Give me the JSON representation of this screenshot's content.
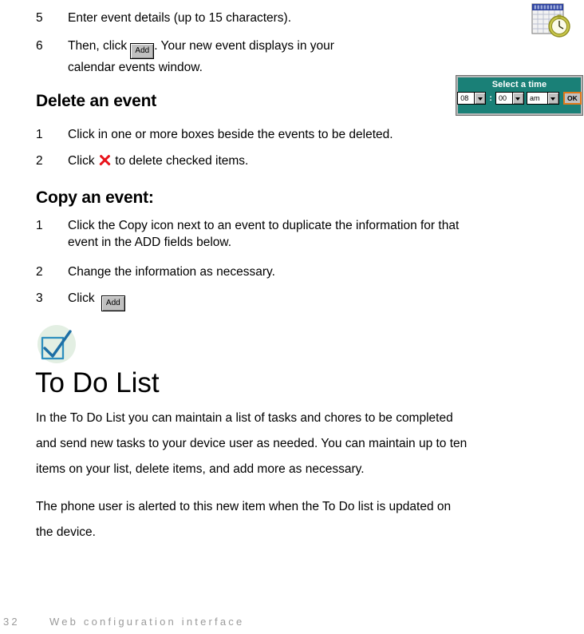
{
  "document": {
    "calendar_steps": [
      {
        "number": "5",
        "lines": [
          "Enter event details (up to 15 characters)."
        ]
      },
      {
        "number": "6",
        "pre_text": "Then, click",
        "button_label": "Add",
        "post_text": ". Your new event displays in your",
        "line2": "calendar events window."
      }
    ],
    "delete_section": {
      "heading": "Delete an event",
      "steps": [
        {
          "number": "1",
          "text": "Click in one or more boxes beside the events to be deleted."
        },
        {
          "number": "2",
          "pre_text": "Click",
          "icon": "red-x-icon",
          "post_text": "to delete checked items."
        }
      ]
    },
    "copy_section": {
      "heading": "Copy an event:",
      "steps": [
        {
          "number": "1",
          "line1": "Click the Copy icon next to an event to duplicate the information for that",
          "line2": "event in the ADD fields below."
        },
        {
          "number": "2",
          "text": "Change the information as necessary."
        },
        {
          "number": "3",
          "pre_text": "Click",
          "button_label": "Add"
        }
      ]
    },
    "todo_section": {
      "icon": "checkmark-box-icon",
      "heading": "To Do List",
      "paragraph1": [
        "In the To Do List you can maintain a list of tasks and chores to be completed",
        "and send new tasks to your device user as needed. You can maintain up to ten",
        "items on your list, delete items, and add more as necessary."
      ],
      "paragraph2": [
        "The phone user is alerted to this new item when the To Do list is updated on",
        "the device."
      ]
    }
  },
  "time_widget": {
    "title": "Select a time",
    "hour": "08",
    "separator": ":",
    "minute": "00",
    "meridiem": "am",
    "ok_label": "OK",
    "background_color": "#1a8077",
    "ok_border_color": "#e07818"
  },
  "icons": {
    "calendar_clock": "calendar-clock-icon",
    "todo_check": "checkmark-box-icon",
    "delete_x": "red-x-icon"
  },
  "footer": {
    "page_number": "32",
    "chapter_title": "Web configuration interface"
  }
}
